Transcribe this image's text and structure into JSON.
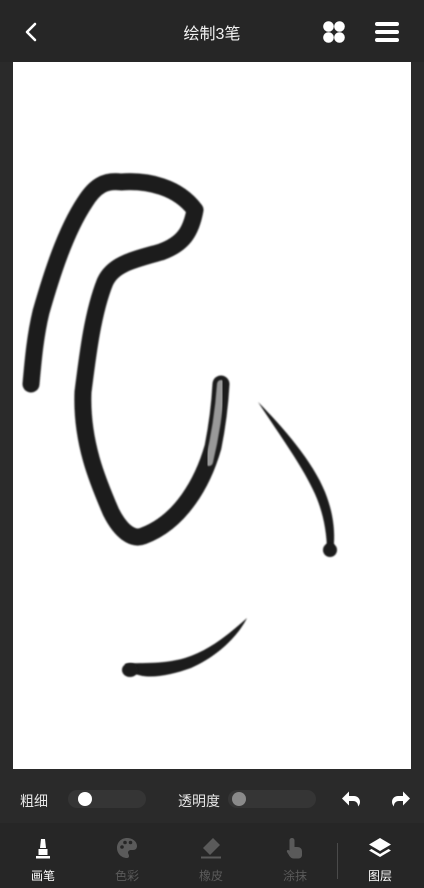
{
  "header": {
    "title": "绘制3笔",
    "back_icon": "chevron-left-icon",
    "grid_icon": "four-dots-icon",
    "menu_icon": "hamburger-menu-icon"
  },
  "controls": {
    "thickness_label": "粗细",
    "thickness_value": 0.1,
    "opacity_label": "透明度",
    "opacity_value": 0.0,
    "undo_icon": "undo-icon",
    "redo_icon": "redo-icon"
  },
  "toolbar": {
    "items": [
      {
        "label": "画笔",
        "icon": "brush-icon",
        "state": "active"
      },
      {
        "label": "色彩",
        "icon": "palette-icon",
        "state": "disabled"
      },
      {
        "label": "橡皮",
        "icon": "eraser-icon",
        "state": "disabled"
      },
      {
        "label": "涂抹",
        "icon": "smudge-finger-icon",
        "state": "disabled"
      },
      {
        "label": "图层",
        "icon": "layers-icon",
        "state": "active"
      }
    ]
  },
  "colors": {
    "background": "#2a2a2a",
    "canvas": "#ffffff",
    "stroke": "#1a1a1a",
    "disabled": "#5a5a5a"
  }
}
